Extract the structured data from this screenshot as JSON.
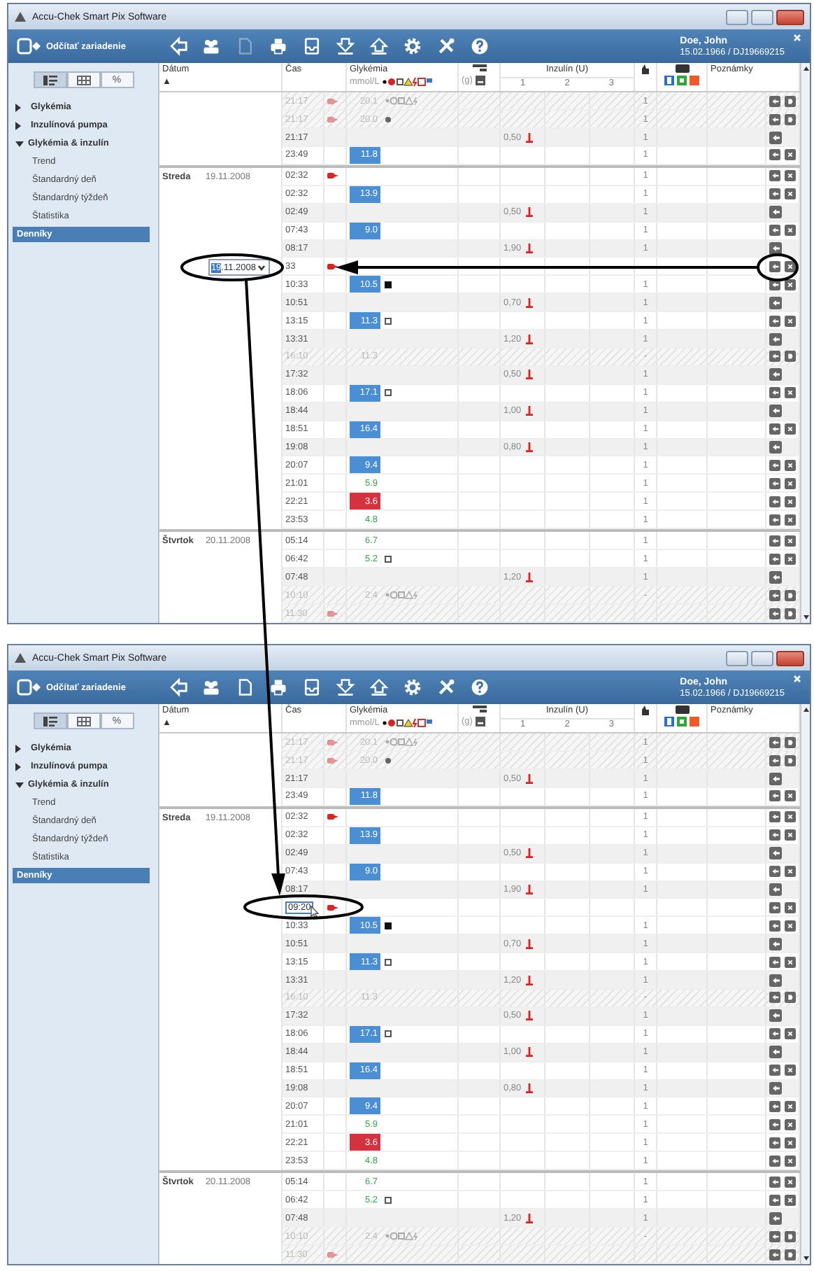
{
  "windows": [
    {
      "title": "Accu-Chek Smart Pix Software",
      "read_button": "Odčítať zariadenie",
      "toolbar": [
        {
          "kind": "back",
          "disabled": false
        },
        {
          "kind": "people",
          "disabled": false
        },
        {
          "kind": "document",
          "disabled": true
        },
        {
          "kind": "printer",
          "disabled": false
        },
        {
          "kind": "tray",
          "disabled": false
        },
        {
          "kind": "download",
          "disabled": false
        },
        {
          "kind": "upload",
          "disabled": false
        },
        {
          "kind": "settings",
          "disabled": false
        },
        {
          "kind": "tools",
          "disabled": false
        },
        {
          "kind": "help",
          "disabled": false
        }
      ],
      "user": {
        "name": "Doe, John",
        "details": "15.02.1966 / DJ19669215"
      },
      "view_toggle": [
        {
          "kind": "list",
          "selected": true
        },
        {
          "kind": "grid",
          "selected": false
        },
        {
          "kind": "text",
          "label": "%",
          "selected": false
        }
      ],
      "tree": [
        {
          "label": "Glykémia",
          "expanded": false
        },
        {
          "label": "Inzulínová pumpa",
          "expanded": false
        },
        {
          "label": "Glykémia & inzulín",
          "expanded": true,
          "children": [
            {
              "label": "Trend",
              "selected": false
            },
            {
              "label": "Štandardný deň",
              "selected": false
            },
            {
              "label": "Štandardný týždeň",
              "selected": false
            },
            {
              "label": "Štatistika",
              "selected": false
            },
            {
              "label": "Denníky",
              "selected": true
            }
          ]
        }
      ],
      "columns": {
        "date": "Dátum",
        "sort": "▲",
        "time": "Čas",
        "glucose": "Glykémia",
        "unit": "mmol/L",
        "carbs_unit": "(g)",
        "insulin": "Inzulín (U)",
        "insulin_sub": [
          "1",
          "2",
          "3"
        ],
        "notes": "Poznámky"
      },
      "groups": [
        {
          "rows": [
            {
              "kind": "hatched",
              "time": "21:17",
              "pen": true,
              "glucose": {
                "value": "20.1",
                "kind": "plain"
              },
              "symbols": true,
              "count": "1",
              "actions": [
                {
                  "kind": "back"
                },
                {
                  "kind": "next"
                }
              ]
            },
            {
              "kind": "hatched",
              "time": "21:17",
              "pen": true,
              "glucose": {
                "value": "20.0",
                "kind": "plain"
              },
              "mark": {
                "kind": "dot"
              },
              "count": "1",
              "actions": [
                {
                  "kind": "back"
                },
                {
                  "kind": "next"
                }
              ]
            },
            {
              "kind": "bolus",
              "time": "21:17",
              "insulin": "0,50",
              "count": "1",
              "actions": [
                {
                  "kind": "back"
                }
              ]
            },
            {
              "kind": "entry",
              "time": "23:49",
              "glucose": {
                "value": "11.8",
                "kind": "high"
              },
              "count": "1",
              "actions": [
                {
                  "kind": "back"
                },
                {
                  "kind": "delete"
                }
              ]
            }
          ]
        },
        {
          "day": "Streda",
          "date": "19.11.2008",
          "rows": [
            {
              "kind": "entry",
              "time": "02:32",
              "pen": true,
              "count": "1",
              "actions": [
                {
                  "kind": "back"
                },
                {
                  "kind": "delete"
                }
              ]
            },
            {
              "kind": "entry",
              "time": "02:32",
              "glucose": {
                "value": "13.9",
                "kind": "high"
              },
              "count": "1",
              "actions": [
                {
                  "kind": "back"
                },
                {
                  "kind": "delete"
                }
              ]
            },
            {
              "kind": "bolus",
              "time": "02:49",
              "insulin": "0,50",
              "count": "1",
              "actions": [
                {
                  "kind": "back"
                }
              ]
            },
            {
              "kind": "entry",
              "time": "07:43",
              "glucose": {
                "value": "9.0",
                "kind": "high"
              },
              "count": "1",
              "actions": [
                {
                  "kind": "back"
                },
                {
                  "kind": "delete"
                }
              ]
            },
            {
              "kind": "bolus",
              "time": "08:17",
              "insulin": "1,90",
              "count": "1",
              "actions": [
                {
                  "kind": "back"
                }
              ]
            },
            {
              "kind": "entry",
              "time": "33",
              "pen": true,
              "date_edit": {
                "selected_part": "19",
                "rest": ".11.2008"
              },
              "actions": [
                {
                  "kind": "back"
                },
                {
                  "kind": "delete"
                }
              ]
            },
            {
              "kind": "entry",
              "time": "10:33",
              "glucose": {
                "value": "10.5",
                "kind": "high"
              },
              "mark": {
                "kind": "filled"
              },
              "count": "1",
              "actions": [
                {
                  "kind": "back"
                },
                {
                  "kind": "delete"
                }
              ]
            },
            {
              "kind": "bolus",
              "time": "10:51",
              "insulin": "0,70",
              "count": "1",
              "actions": [
                {
                  "kind": "back"
                }
              ]
            },
            {
              "kind": "entry",
              "time": "13:15",
              "glucose": {
                "value": "11.3",
                "kind": "high"
              },
              "mark": {
                "kind": "hollow"
              },
              "count": "1",
              "actions": [
                {
                  "kind": "back"
                },
                {
                  "kind": "delete"
                }
              ]
            },
            {
              "kind": "bolus",
              "time": "13:31",
              "insulin": "1,20",
              "count": "1",
              "actions": [
                {
                  "kind": "back"
                }
              ]
            },
            {
              "kind": "hatched",
              "time": "16:10",
              "glucose": {
                "value": "11.3",
                "kind": "plain"
              },
              "count": "-",
              "actions": [
                {
                  "kind": "back"
                },
                {
                  "kind": "next"
                }
              ]
            },
            {
              "kind": "bolus",
              "time": "17:32",
              "insulin": "0,50",
              "count": "1",
              "actions": [
                {
                  "kind": "back"
                }
              ]
            },
            {
              "kind": "entry",
              "time": "18:06",
              "glucose": {
                "value": "17.1",
                "kind": "high"
              },
              "mark": {
                "kind": "hollow"
              },
              "count": "1",
              "actions": [
                {
                  "kind": "back"
                },
                {
                  "kind": "delete"
                }
              ]
            },
            {
              "kind": "bolus",
              "time": "18:44",
              "insulin": "1,00",
              "count": "1",
              "actions": [
                {
                  "kind": "back"
                }
              ]
            },
            {
              "kind": "entry",
              "time": "18:51",
              "glucose": {
                "value": "16.4",
                "kind": "high"
              },
              "count": "1",
              "actions": [
                {
                  "kind": "back"
                },
                {
                  "kind": "delete"
                }
              ]
            },
            {
              "kind": "bolus",
              "time": "19:08",
              "insulin": "0,80",
              "count": "1",
              "actions": [
                {
                  "kind": "back"
                }
              ]
            },
            {
              "kind": "entry",
              "time": "20:07",
              "glucose": {
                "value": "9.4",
                "kind": "high"
              },
              "count": "1",
              "actions": [
                {
                  "kind": "back"
                },
                {
                  "kind": "delete"
                }
              ]
            },
            {
              "kind": "entry",
              "time": "21:01",
              "glucose": {
                "value": "5.9",
                "kind": "target"
              },
              "count": "1",
              "actions": [
                {
                  "kind": "back"
                },
                {
                  "kind": "delete"
                }
              ]
            },
            {
              "kind": "entry",
              "time": "22:21",
              "glucose": {
                "value": "3.6",
                "kind": "low"
              },
              "count": "1",
              "actions": [
                {
                  "kind": "back"
                },
                {
                  "kind": "delete"
                }
              ]
            },
            {
              "kind": "entry",
              "time": "23:53",
              "glucose": {
                "value": "4.8",
                "kind": "target"
              },
              "count": "1",
              "actions": [
                {
                  "kind": "back"
                },
                {
                  "kind": "delete"
                }
              ]
            }
          ]
        },
        {
          "day": "Štvrtok",
          "date": "20.11.2008",
          "rows": [
            {
              "kind": "entry",
              "time": "05:14",
              "glucose": {
                "value": "6.7",
                "kind": "target"
              },
              "count": "1",
              "actions": [
                {
                  "kind": "back"
                },
                {
                  "kind": "delete"
                }
              ]
            },
            {
              "kind": "entry",
              "time": "06:42",
              "glucose": {
                "value": "5.2",
                "kind": "target"
              },
              "mark": {
                "kind": "hollow"
              },
              "count": "1",
              "actions": [
                {
                  "kind": "back"
                },
                {
                  "kind": "delete"
                }
              ]
            },
            {
              "kind": "bolus",
              "time": "07:48",
              "insulin": "1,20",
              "count": "1",
              "actions": [
                {
                  "kind": "back"
                }
              ]
            },
            {
              "kind": "hatched",
              "time": "10:10",
              "glucose": {
                "value": "2.4",
                "kind": "plain"
              },
              "symbols": true,
              "count": "-",
              "actions": [
                {
                  "kind": "back"
                },
                {
                  "kind": "next"
                }
              ]
            },
            {
              "kind": "hatched",
              "time": "11:30",
              "pen": true,
              "actions": [
                {
                  "kind": "back"
                },
                {
                  "kind": "next"
                }
              ]
            }
          ]
        }
      ]
    },
    {
      "title": "Accu-Chek Smart Pix Software",
      "read_button": "Odčítať zariadenie",
      "toolbar": [
        {
          "kind": "back",
          "disabled": false
        },
        {
          "kind": "people",
          "disabled": false
        },
        {
          "kind": "document",
          "disabled": false
        },
        {
          "kind": "printer",
          "disabled": false
        },
        {
          "kind": "tray",
          "disabled": false
        },
        {
          "kind": "download",
          "disabled": false
        },
        {
          "kind": "upload",
          "disabled": false
        },
        {
          "kind": "settings",
          "disabled": false
        },
        {
          "kind": "tools",
          "disabled": false
        },
        {
          "kind": "help",
          "disabled": false
        }
      ],
      "user": {
        "name": "Doe, John",
        "details": "15.02.1966 / DJ19669215"
      },
      "view_toggle": [
        {
          "kind": "list",
          "selected": true
        },
        {
          "kind": "grid",
          "selected": false
        },
        {
          "kind": "text",
          "label": "%",
          "selected": false
        }
      ],
      "tree": [
        {
          "label": "Glykémia",
          "expanded": false
        },
        {
          "label": "Inzulínová pumpa",
          "expanded": false
        },
        {
          "label": "Glykémia & inzulín",
          "expanded": true,
          "children": [
            {
              "label": "Trend",
              "selected": false
            },
            {
              "label": "Štandardný deň",
              "selected": false
            },
            {
              "label": "Štandardný týždeň",
              "selected": false
            },
            {
              "label": "Štatistika",
              "selected": false
            },
            {
              "label": "Denníky",
              "selected": true
            }
          ]
        }
      ],
      "columns": {
        "date": "Dátum",
        "sort": "▲",
        "time": "Čas",
        "glucose": "Glykémia",
        "unit": "mmol/L",
        "carbs_unit": "(g)",
        "insulin": "Inzulín (U)",
        "insulin_sub": [
          "1",
          "2",
          "3"
        ],
        "notes": "Poznámky"
      },
      "groups": [
        {
          "rows": [
            {
              "kind": "hatched",
              "time": "21:17",
              "pen": true,
              "glucose": {
                "value": "20.1",
                "kind": "plain"
              },
              "symbols": true,
              "count": "1",
              "actions": [
                {
                  "kind": "back"
                },
                {
                  "kind": "next"
                }
              ]
            },
            {
              "kind": "hatched",
              "time": "21:17",
              "pen": true,
              "glucose": {
                "value": "20.0",
                "kind": "plain"
              },
              "mark": {
                "kind": "dot"
              },
              "count": "1",
              "actions": [
                {
                  "kind": "back"
                },
                {
                  "kind": "next"
                }
              ]
            },
            {
              "kind": "bolus",
              "time": "21:17",
              "insulin": "0,50",
              "count": "1",
              "actions": [
                {
                  "kind": "back"
                }
              ]
            },
            {
              "kind": "entry",
              "time": "23:49",
              "glucose": {
                "value": "11.8",
                "kind": "high"
              },
              "count": "1",
              "actions": [
                {
                  "kind": "back"
                },
                {
                  "kind": "delete"
                }
              ]
            }
          ]
        },
        {
          "day": "Streda",
          "date": "19.11.2008",
          "rows": [
            {
              "kind": "entry",
              "time": "02:32",
              "pen": true,
              "count": "1",
              "actions": [
                {
                  "kind": "back"
                },
                {
                  "kind": "delete"
                }
              ]
            },
            {
              "kind": "entry",
              "time": "02:32",
              "glucose": {
                "value": "13.9",
                "kind": "high"
              },
              "count": "1",
              "actions": [
                {
                  "kind": "back"
                },
                {
                  "kind": "delete"
                }
              ]
            },
            {
              "kind": "bolus",
              "time": "02:49",
              "insulin": "0,50",
              "count": "1",
              "actions": [
                {
                  "kind": "back"
                }
              ]
            },
            {
              "kind": "entry",
              "time": "07:43",
              "glucose": {
                "value": "9.0",
                "kind": "high"
              },
              "count": "1",
              "actions": [
                {
                  "kind": "back"
                },
                {
                  "kind": "delete"
                }
              ]
            },
            {
              "kind": "bolus",
              "time": "08:17",
              "insulin": "1,90",
              "count": "1",
              "actions": [
                {
                  "kind": "back"
                }
              ]
            },
            {
              "kind": "entry",
              "time": "09:20",
              "pen": true,
              "time_edit": true,
              "pointer": true,
              "actions": [
                {
                  "kind": "back"
                },
                {
                  "kind": "delete"
                }
              ]
            },
            {
              "kind": "entry",
              "time": "10:33",
              "glucose": {
                "value": "10.5",
                "kind": "high"
              },
              "mark": {
                "kind": "filled"
              },
              "count": "1",
              "actions": [
                {
                  "kind": "back"
                },
                {
                  "kind": "delete"
                }
              ]
            },
            {
              "kind": "bolus",
              "time": "10:51",
              "insulin": "0,70",
              "count": "1",
              "actions": [
                {
                  "kind": "back"
                }
              ]
            },
            {
              "kind": "entry",
              "time": "13:15",
              "glucose": {
                "value": "11.3",
                "kind": "high"
              },
              "mark": {
                "kind": "hollow"
              },
              "count": "1",
              "actions": [
                {
                  "kind": "back"
                },
                {
                  "kind": "delete"
                }
              ]
            },
            {
              "kind": "bolus",
              "time": "13:31",
              "insulin": "1,20",
              "count": "1",
              "actions": [
                {
                  "kind": "back"
                }
              ]
            },
            {
              "kind": "hatched",
              "time": "16:10",
              "glucose": {
                "value": "11.3",
                "kind": "plain"
              },
              "count": "-",
              "actions": [
                {
                  "kind": "back"
                },
                {
                  "kind": "next"
                }
              ]
            },
            {
              "kind": "bolus",
              "time": "17:32",
              "insulin": "0,50",
              "count": "1",
              "actions": [
                {
                  "kind": "back"
                }
              ]
            },
            {
              "kind": "entry",
              "time": "18:06",
              "glucose": {
                "value": "17.1",
                "kind": "high"
              },
              "mark": {
                "kind": "hollow"
              },
              "count": "1",
              "actions": [
                {
                  "kind": "back"
                },
                {
                  "kind": "delete"
                }
              ]
            },
            {
              "kind": "bolus",
              "time": "18:44",
              "insulin": "1,00",
              "count": "1",
              "actions": [
                {
                  "kind": "back"
                }
              ]
            },
            {
              "kind": "entry",
              "time": "18:51",
              "glucose": {
                "value": "16.4",
                "kind": "high"
              },
              "count": "1",
              "actions": [
                {
                  "kind": "back"
                },
                {
                  "kind": "delete"
                }
              ]
            },
            {
              "kind": "bolus",
              "time": "19:08",
              "insulin": "0,80",
              "count": "1",
              "actions": [
                {
                  "kind": "back"
                }
              ]
            },
            {
              "kind": "entry",
              "time": "20:07",
              "glucose": {
                "value": "9.4",
                "kind": "high"
              },
              "count": "1",
              "actions": [
                {
                  "kind": "back"
                },
                {
                  "kind": "delete"
                }
              ]
            },
            {
              "kind": "entry",
              "time": "21:01",
              "glucose": {
                "value": "5.9",
                "kind": "target"
              },
              "count": "1",
              "actions": [
                {
                  "kind": "back"
                },
                {
                  "kind": "delete"
                }
              ]
            },
            {
              "kind": "entry",
              "time": "22:21",
              "glucose": {
                "value": "3.6",
                "kind": "low"
              },
              "count": "1",
              "actions": [
                {
                  "kind": "back"
                },
                {
                  "kind": "delete"
                }
              ]
            },
            {
              "kind": "entry",
              "time": "23:53",
              "glucose": {
                "value": "4.8",
                "kind": "target"
              },
              "count": "1",
              "actions": [
                {
                  "kind": "back"
                },
                {
                  "kind": "delete"
                }
              ]
            }
          ]
        },
        {
          "day": "Štvrtok",
          "date": "20.11.2008",
          "rows": [
            {
              "kind": "entry",
              "time": "05:14",
              "glucose": {
                "value": "6.7",
                "kind": "target"
              },
              "count": "1",
              "actions": [
                {
                  "kind": "back"
                },
                {
                  "kind": "delete"
                }
              ]
            },
            {
              "kind": "entry",
              "time": "06:42",
              "glucose": {
                "value": "5.2",
                "kind": "target"
              },
              "mark": {
                "kind": "hollow"
              },
              "count": "1",
              "actions": [
                {
                  "kind": "back"
                },
                {
                  "kind": "delete"
                }
              ]
            },
            {
              "kind": "bolus",
              "time": "07:48",
              "insulin": "1,20",
              "count": "1",
              "actions": [
                {
                  "kind": "back"
                }
              ]
            },
            {
              "kind": "hatched",
              "time": "10:10",
              "glucose": {
                "value": "2.4",
                "kind": "plain"
              },
              "symbols": true,
              "count": "-",
              "actions": [
                {
                  "kind": "back"
                },
                {
                  "kind": "next"
                }
              ]
            },
            {
              "kind": "hatched",
              "time": "11:30",
              "pen": true,
              "actions": [
                {
                  "kind": "back"
                },
                {
                  "kind": "next"
                }
              ]
            }
          ]
        }
      ]
    }
  ]
}
